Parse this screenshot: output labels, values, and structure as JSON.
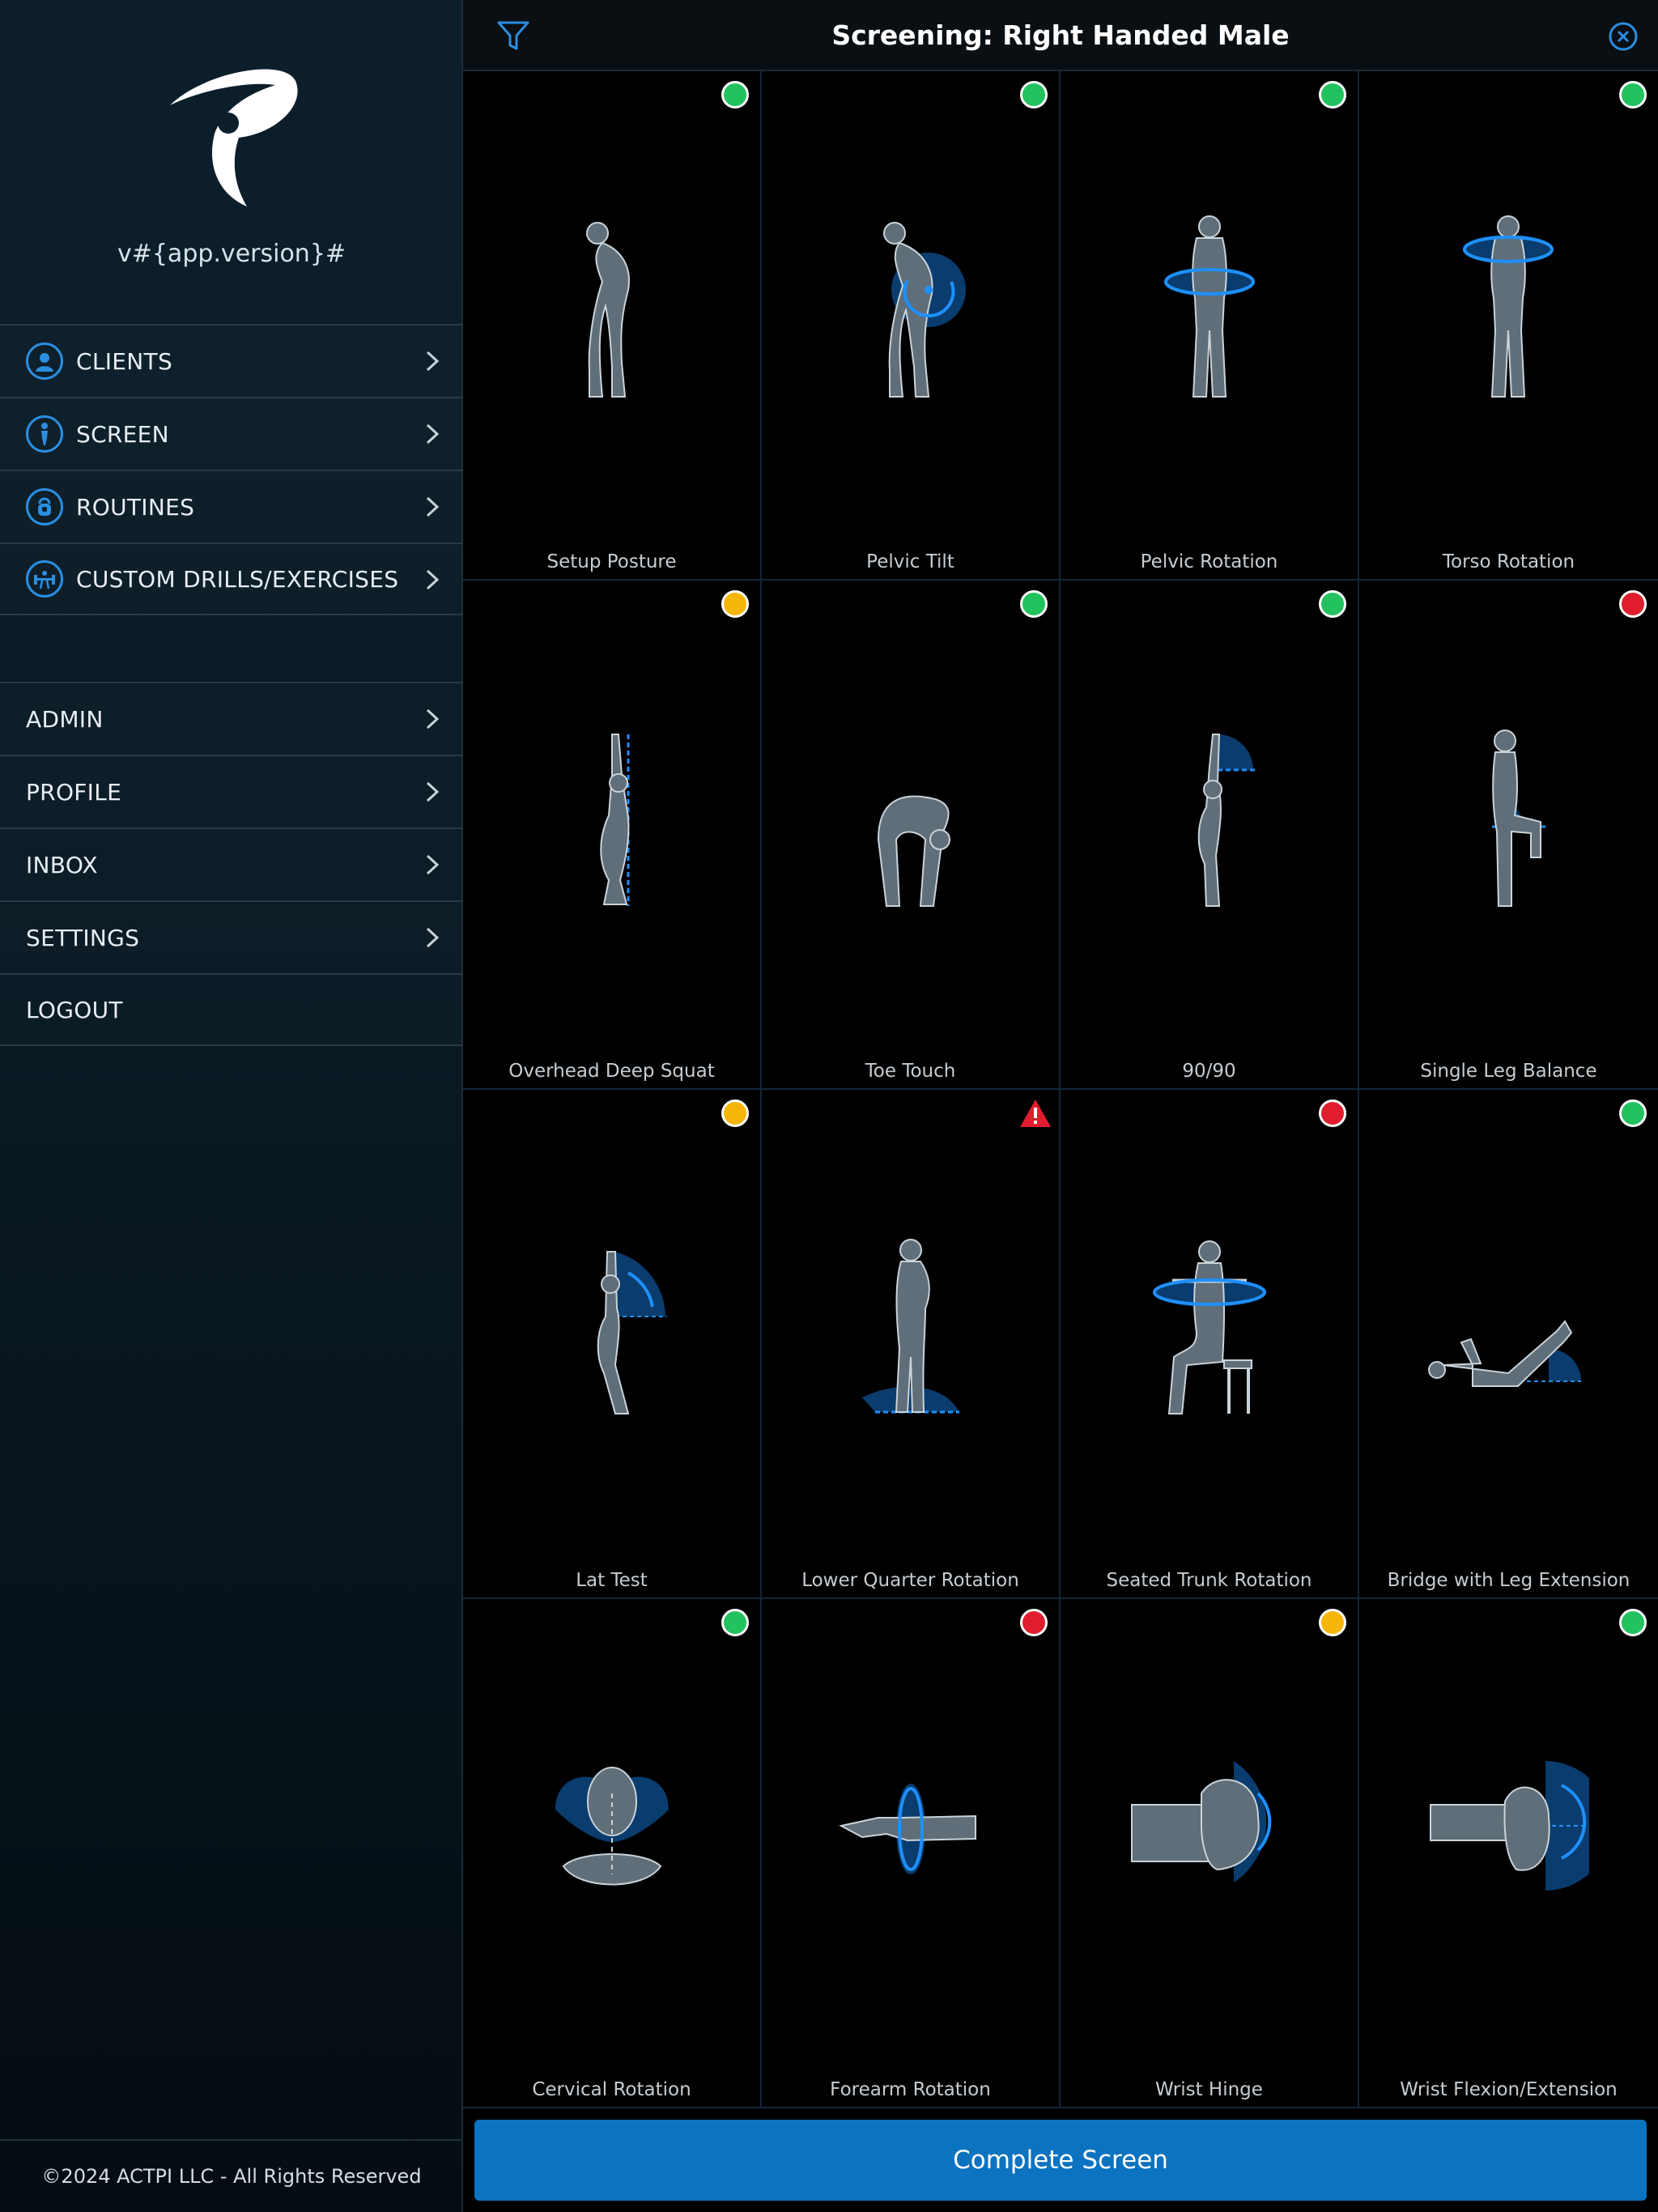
{
  "app": {
    "version_text": "v#{app.version}#",
    "copyright": "©2024 ACTPI LLC - All Rights Reserved",
    "accent_color": "#2b8ee0"
  },
  "sidebar": {
    "primary_items": [
      {
        "label": "CLIENTS",
        "icon": "user-icon"
      },
      {
        "label": "SCREEN",
        "icon": "figure-icon"
      },
      {
        "label": "ROUTINES",
        "icon": "kettlebell-icon"
      },
      {
        "label": "CUSTOM DRILLS/EXERCISES",
        "icon": "dumbbell-icon"
      }
    ],
    "secondary_items": [
      {
        "label": "ADMIN"
      },
      {
        "label": "PROFILE"
      },
      {
        "label": "INBOX"
      },
      {
        "label": "SETTINGS"
      },
      {
        "label": "LOGOUT"
      }
    ]
  },
  "header": {
    "title": "Screening: Right Handed Male",
    "filter_icon": "filter-icon",
    "close_icon": "close-icon"
  },
  "tests": [
    {
      "label": "Setup Posture",
      "status": "green"
    },
    {
      "label": "Pelvic Tilt",
      "status": "green"
    },
    {
      "label": "Pelvic Rotation",
      "status": "green"
    },
    {
      "label": "Torso Rotation",
      "status": "green"
    },
    {
      "label": "Overhead Deep Squat",
      "status": "yellow"
    },
    {
      "label": "Toe Touch",
      "status": "green"
    },
    {
      "label": "90/90",
      "status": "green"
    },
    {
      "label": "Single Leg Balance",
      "status": "red"
    },
    {
      "label": "Lat Test",
      "status": "yellow"
    },
    {
      "label": "Lower Quarter Rotation",
      "status": "warning"
    },
    {
      "label": "Seated Trunk Rotation",
      "status": "red"
    },
    {
      "label": "Bridge with Leg Extension",
      "status": "green"
    },
    {
      "label": "Cervical Rotation",
      "status": "green"
    },
    {
      "label": "Forearm Rotation",
      "status": "red"
    },
    {
      "label": "Wrist Hinge",
      "status": "yellow"
    },
    {
      "label": "Wrist Flexion/Extension",
      "status": "green"
    }
  ],
  "status_colors": {
    "green": "#22c25f",
    "yellow": "#f5b50a",
    "red": "#e01d2e"
  },
  "footer": {
    "complete_label": "Complete Screen"
  }
}
